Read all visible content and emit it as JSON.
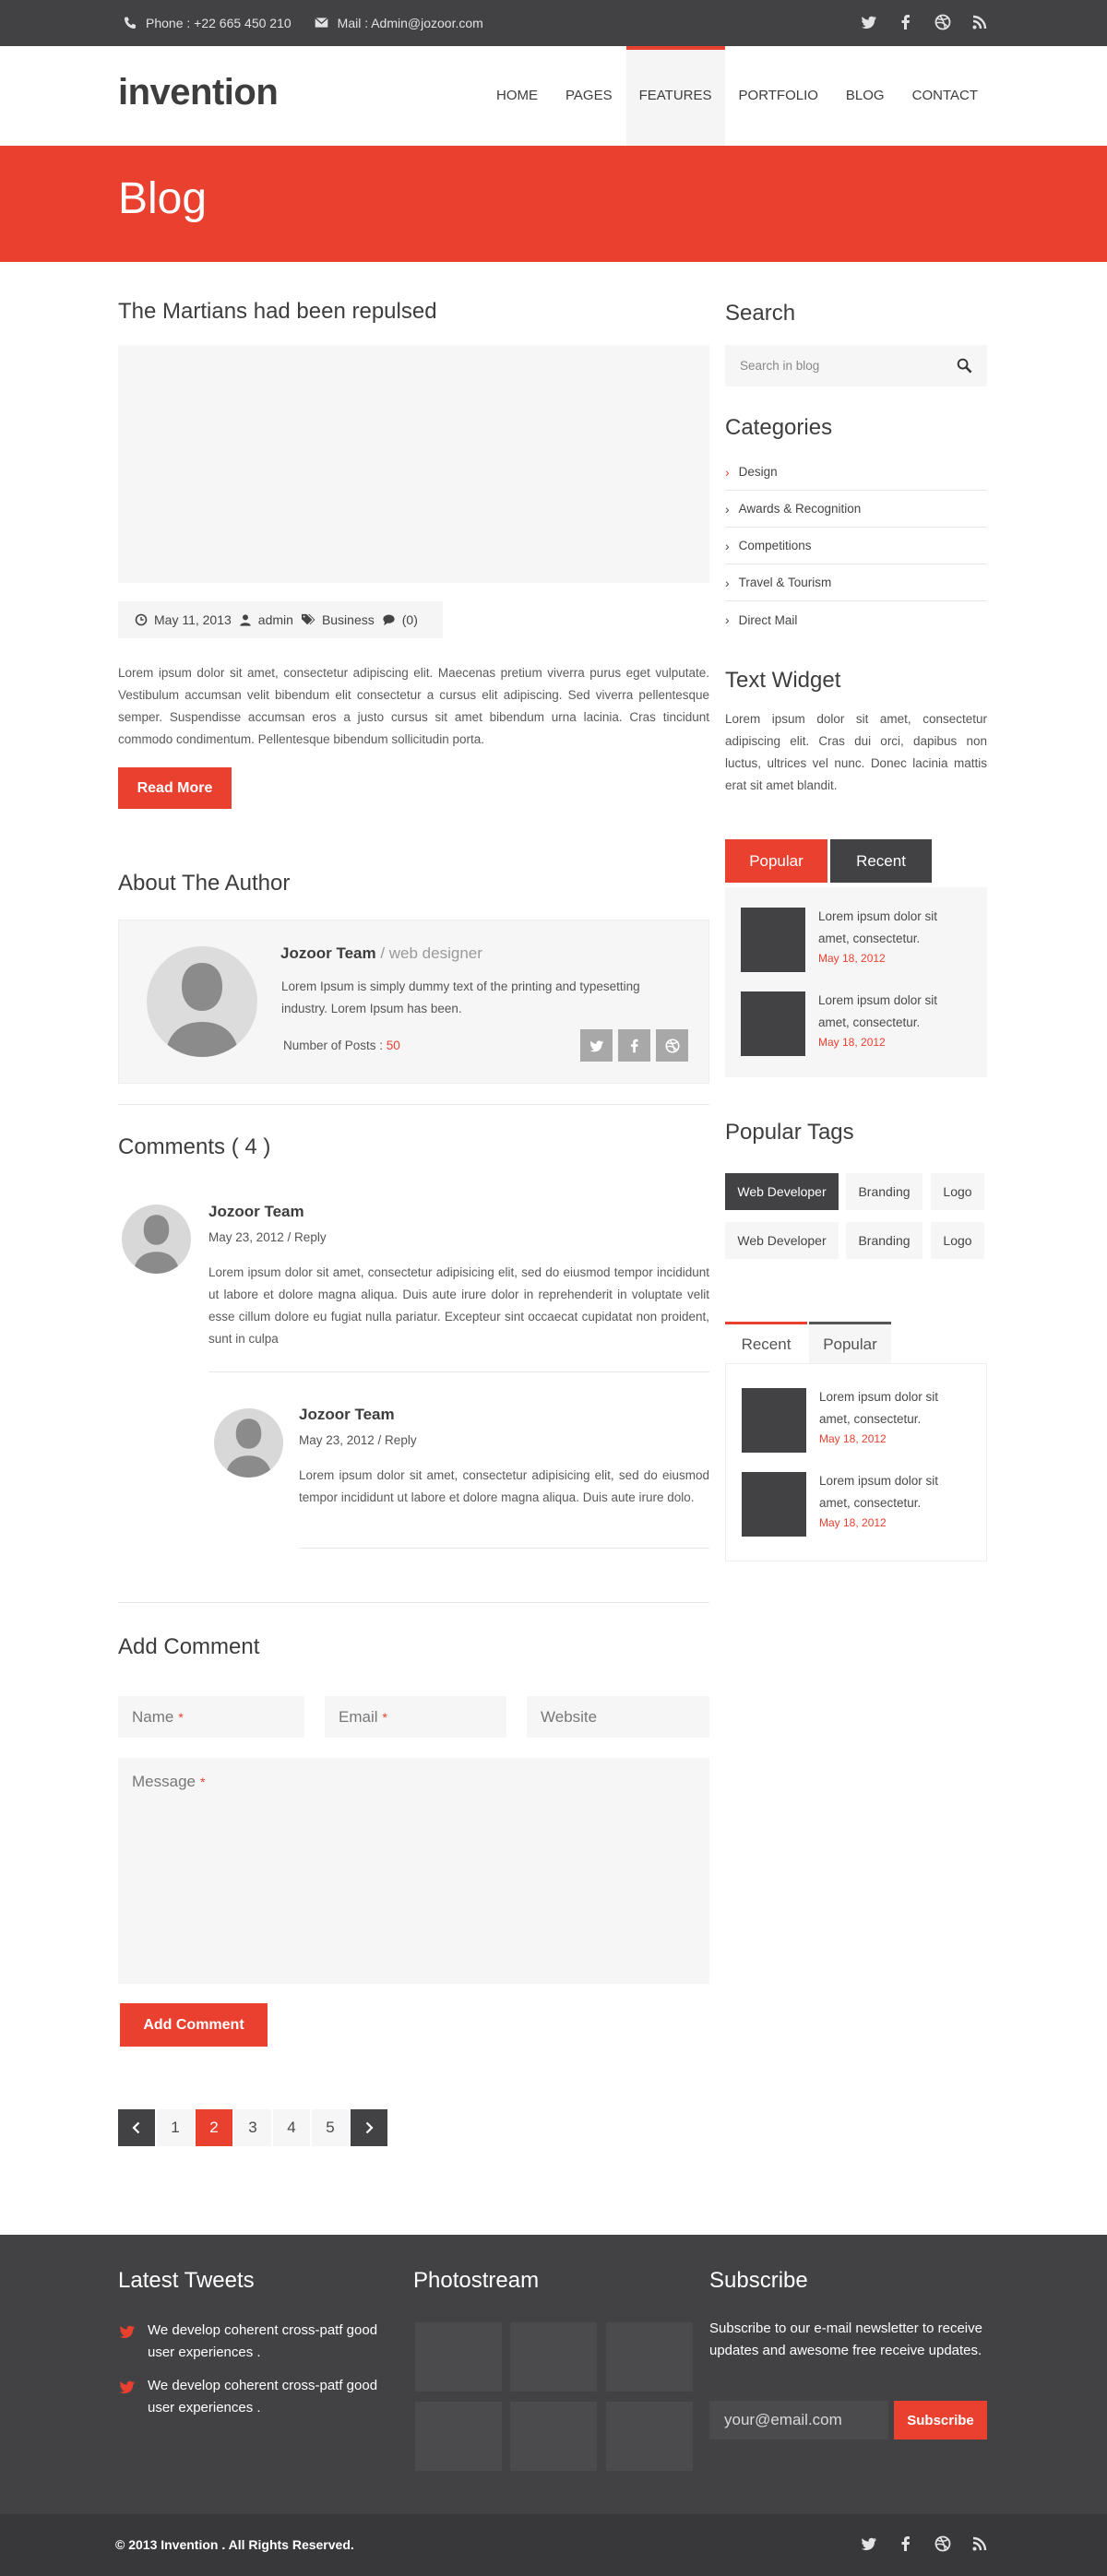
{
  "topbar": {
    "phone": "Phone : +22 665 450 210",
    "mail": "Mail : Admin@jozoor.com",
    "social_icons": [
      "twitter-icon",
      "facebook-icon",
      "dribbble-icon",
      "rss-icon"
    ]
  },
  "header": {
    "logo": "invention",
    "nav": [
      {
        "label": "HOME"
      },
      {
        "label": "PAGES"
      },
      {
        "label": "FEATURES",
        "active": true
      },
      {
        "label": "PORTFOLIO"
      },
      {
        "label": "BLOG"
      },
      {
        "label": "CONTACT"
      }
    ]
  },
  "banner": {
    "title": "Blog"
  },
  "post": {
    "title": "The Martians had been repulsed",
    "date": "May 11, 2013",
    "author": "admin",
    "category": "Business",
    "comments": "(0)",
    "text": "Lorem ipsum dolor sit amet, consectetur adipiscing elit. Maecenas pretium viverra purus eget vulputate. Vestibulum accumsan velit bibendum elit consectetur a cursus elit adipiscing. Sed viverra pellentesque semper. Suspendisse accumsan eros a justo cursus sit amet bibendum urna lacinia. Cras tincidunt commodo condimentum. Pellentesque bibendum sollicitudin porta.",
    "read_more": "Read More"
  },
  "author": {
    "section_title": "About The Author",
    "name": "Jozoor Team",
    "separator": " / ",
    "role": "web designer",
    "desc": "Lorem Ipsum is simply dummy text of the printing and typesetting industry. Lorem Ipsum has been.",
    "posts_label": "Number of Posts : ",
    "posts_count": "50"
  },
  "comments": {
    "title": "Comments ( 4 )",
    "items": [
      {
        "name": "Jozoor Team",
        "date": "May 23, 2012 / Reply",
        "text": "Lorem ipsum dolor sit amet, consectetur adipisicing elit, sed do eiusmod tempor incididunt ut labore et dolore magna aliqua. Duis aute irure dolor in reprehenderit in voluptate velit esse cillum dolore eu fugiat nulla pariatur. Excepteur sint occaecat cupidatat non proident, sunt in culpa"
      },
      {
        "name": "Jozoor Team",
        "date": "May 23, 2012 / Reply",
        "text": "Lorem ipsum dolor sit amet, consectetur adipisicing elit, sed do eiusmod tempor incididunt ut labore et dolore magna aliqua. Duis aute irure dolo."
      }
    ]
  },
  "add_comment": {
    "title": "Add Comment",
    "name_ph": "Name",
    "email_ph": "Email",
    "website_ph": "Website",
    "message_ph": "Message",
    "required_mark": "*",
    "submit": "Add Comment"
  },
  "pagination": {
    "pages": [
      "1",
      "2",
      "3",
      "4",
      "5"
    ],
    "active": "2"
  },
  "sidebar": {
    "search_title": "Search",
    "search_ph": "Search in blog",
    "categories_title": "Categories",
    "categories": [
      "Design",
      "Awards & Recognition",
      "Competitions",
      "Travel & Tourism",
      "Direct Mail"
    ],
    "text_widget_title": "Text Widget",
    "text_widget": "Lorem ipsum dolor sit amet, consectetur adipiscing elit. Cras dui orci, dapibus non luctus, ultrices vel nunc. Donec lacinia mattis erat sit amet blandit.",
    "tab_popular": "Popular",
    "tab_recent": "Recent",
    "posts": [
      {
        "text": "Lorem ipsum dolor sit amet, consectetur.",
        "date": "May 18, 2012"
      },
      {
        "text": "Lorem ipsum dolor sit amet, consectetur.",
        "date": "May 18, 2012"
      }
    ],
    "tags_title": "Popular Tags",
    "tags": [
      "Web Developer",
      "Branding",
      "Logo",
      "Web Developer",
      "Branding",
      "Logo"
    ],
    "tab2_recent": "Recent",
    "tab2_popular": "Popular",
    "posts2": [
      {
        "text": "Lorem ipsum dolor sit amet, consectetur.",
        "date": "May 18, 2012"
      },
      {
        "text": "Lorem ipsum dolor sit amet, consectetur.",
        "date": "May 18, 2012"
      }
    ]
  },
  "footer": {
    "tweets_title": "Latest Tweets",
    "tweets": [
      "We develop coherent cross-patf good user experiences .",
      "We develop coherent cross-patf good user experiences ."
    ],
    "photostream_title": "Photostream",
    "subscribe_title": "Subscribe",
    "subscribe_text": "Subscribe to our e-mail newsletter to receive updates and awesome free receive updates.",
    "email_ph": "your@email.com",
    "subscribe_btn": "Subscribe",
    "copyright": "© 2013 Invention . All Rights Reserved."
  },
  "colors": {
    "accent": "#e94030",
    "dark": "#424244"
  }
}
